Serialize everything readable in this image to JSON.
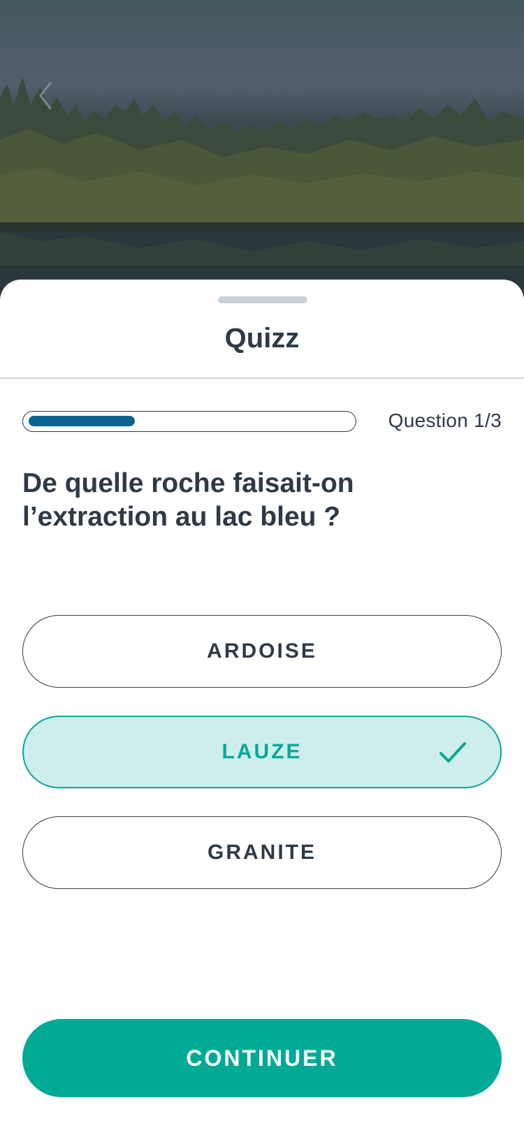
{
  "header": {
    "back_icon": "chevron-left-icon",
    "background": "dimmed lake and forest photo"
  },
  "sheet": {
    "title": "Quizz",
    "progress": {
      "fraction": 0.33,
      "label": "Question 1/3"
    },
    "question": "De quelle roche faisait-on l’extraction au lac bleu ?",
    "answers": [
      {
        "label": "ARDOISE",
        "selected": false
      },
      {
        "label": "LAUZE",
        "selected": true,
        "icon": "checkmark-icon"
      },
      {
        "label": "GRANITE",
        "selected": false
      }
    ],
    "continue_label": "CONTINUER"
  },
  "colors": {
    "accent": "#02aa96",
    "selected_bg": "#cdeeeb",
    "progress": "#0b6390",
    "text": "#2f3a46"
  }
}
